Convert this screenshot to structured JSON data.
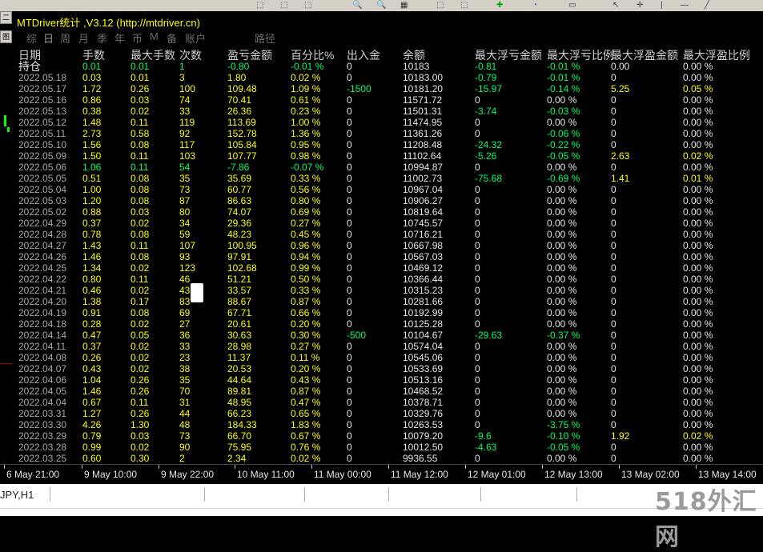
{
  "window": {
    "title": "MTDriver统计 ,V3.12 (http://mtdriver.cn)"
  },
  "tabs": [
    "综",
    "日",
    "周",
    "月",
    "季",
    "年",
    "币",
    "M",
    "备",
    "账户",
    "路径"
  ],
  "columns": [
    "日期",
    "手数",
    "最大手数",
    "次数",
    "盈亏金额",
    "百分比%",
    "出入金",
    "余额",
    "最大浮亏金额",
    "最大浮亏比例",
    "最大浮盈金额",
    "最大浮盈比例"
  ],
  "holding": {
    "label": "持仓",
    "lots": "0.01",
    "max_lots": "0.01",
    "count": "1",
    "pnl": "-0.80",
    "pct": "-0.01 %",
    "flow": "0",
    "balance": "10183",
    "max_loss": "-0.81",
    "max_loss_pct": "-0.01 %",
    "max_gain": "0.00",
    "max_gain_pct": "0.00 %"
  },
  "rows": [
    [
      "2022.05.18",
      "0.03",
      "0.01",
      "3",
      "1.80",
      "0.02 %",
      "0",
      "10183.00",
      "-0.79",
      "-0.01 %",
      "0",
      "0.00 %"
    ],
    [
      "2022.05.17",
      "1.72",
      "0.26",
      "100",
      "109.48",
      "1.09 %",
      "-1500",
      "10181.20",
      "-15.97",
      "-0.14 %",
      "5.25",
      "0.05 %"
    ],
    [
      "2022.05.16",
      "0.86",
      "0.03",
      "74",
      "70.41",
      "0.61 %",
      "0",
      "11571.72",
      "0",
      "0.00 %",
      "0",
      "0.00 %"
    ],
    [
      "2022.05.13",
      "0.38",
      "0.02",
      "33",
      "26.36",
      "0.23 %",
      "0",
      "11501.31",
      "-3.74",
      "-0.03 %",
      "0",
      "0.00 %"
    ],
    [
      "2022.05.12",
      "1.48",
      "0.11",
      "119",
      "113.69",
      "1.00 %",
      "0",
      "11474.95",
      "0",
      "0.00 %",
      "0",
      "0.00 %"
    ],
    [
      "2022.05.11",
      "2.73",
      "0.58",
      "92",
      "152.78",
      "1.36 %",
      "0",
      "11361.26",
      "0",
      "-0.06 %",
      "0",
      "0.00 %"
    ],
    [
      "2022.05.10",
      "1.56",
      "0.08",
      "117",
      "105.84",
      "0.95 %",
      "0",
      "11208.48",
      "-24.32",
      "-0.22 %",
      "0",
      "0.00 %"
    ],
    [
      "2022.05.09",
      "1.50",
      "0.11",
      "103",
      "107.77",
      "0.98 %",
      "0",
      "11102.64",
      "-5.26",
      "-0.05 %",
      "2.63",
      "0.02 %"
    ],
    [
      "2022.05.06",
      "1.06",
      "0.11",
      "54",
      "-7.86",
      "-0.07 %",
      "0",
      "10994.87",
      "0",
      "0.00 %",
      "0",
      "0.00 %"
    ],
    [
      "2022.05.05",
      "0.51",
      "0.08",
      "35",
      "35.69",
      "0.33 %",
      "0",
      "11002.73",
      "-75.68",
      "-0.69 %",
      "1.41",
      "0.01 %"
    ],
    [
      "2022.05.04",
      "1.00",
      "0.08",
      "73",
      "60.77",
      "0.56 %",
      "0",
      "10967.04",
      "0",
      "0.00 %",
      "0",
      "0.00 %"
    ],
    [
      "2022.05.03",
      "1.20",
      "0.08",
      "87",
      "86.63",
      "0.80 %",
      "0",
      "10906.27",
      "0",
      "0.00 %",
      "0",
      "0.00 %"
    ],
    [
      "2022.05.02",
      "0.88",
      "0.03",
      "80",
      "74.07",
      "0.69 %",
      "0",
      "10819.64",
      "0",
      "0.00 %",
      "0",
      "0.00 %"
    ],
    [
      "2022.04.29",
      "0.37",
      "0.02",
      "34",
      "29.36",
      "0.27 %",
      "0",
      "10745.57",
      "0",
      "0.00 %",
      "0",
      "0.00 %"
    ],
    [
      "2022.04.28",
      "0.78",
      "0.08",
      "59",
      "48.23",
      "0.45 %",
      "0",
      "10716.21",
      "0",
      "0.00 %",
      "0",
      "0.00 %"
    ],
    [
      "2022.04.27",
      "1.43",
      "0.11",
      "107",
      "100.95",
      "0.96 %",
      "0",
      "10667.98",
      "0",
      "0.00 %",
      "0",
      "0.00 %"
    ],
    [
      "2022.04.26",
      "1.46",
      "0.08",
      "93",
      "97.91",
      "0.94 %",
      "0",
      "10567.03",
      "0",
      "0.00 %",
      "0",
      "0.00 %"
    ],
    [
      "2022.04.25",
      "1.34",
      "0.02",
      "123",
      "102.68",
      "0.99 %",
      "0",
      "10469.12",
      "0",
      "0.00 %",
      "0",
      "0.00 %"
    ],
    [
      "2022.04.22",
      "0.80",
      "0.11",
      "46",
      "51.21",
      "0.50 %",
      "0",
      "10366.44",
      "0",
      "0.00 %",
      "0",
      "0.00 %"
    ],
    [
      "2022.04.21",
      "0.46",
      "0.02",
      "43",
      "33.57",
      "0.33 %",
      "0",
      "10315.23",
      "0",
      "0.00 %",
      "0",
      "0.00 %"
    ],
    [
      "2022.04.20",
      "1.38",
      "0.17",
      "83",
      "88.67",
      "0.87 %",
      "0",
      "10281.66",
      "0",
      "0.00 %",
      "0",
      "0.00 %"
    ],
    [
      "2022.04.19",
      "0.91",
      "0.08",
      "69",
      "67.71",
      "0.66 %",
      "0",
      "10192.99",
      "0",
      "0.00 %",
      "0",
      "0.00 %"
    ],
    [
      "2022.04.18",
      "0.28",
      "0.02",
      "27",
      "20.61",
      "0.20 %",
      "0",
      "10125.28",
      "0",
      "0.00 %",
      "0",
      "0.00 %"
    ],
    [
      "2022.04.14",
      "0.47",
      "0.05",
      "36",
      "30.63",
      "0.30 %",
      "-500",
      "10104.67",
      "-29.63",
      "-0.37 %",
      "0",
      "0.00 %"
    ],
    [
      "2022.04.11",
      "0.37",
      "0.02",
      "33",
      "28.98",
      "0.27 %",
      "0",
      "10574.04",
      "0",
      "0.00 %",
      "0",
      "0.00 %"
    ],
    [
      "2022.04.08",
      "0.26",
      "0.02",
      "23",
      "11.37",
      "0.11 %",
      "0",
      "10545.06",
      "0",
      "0.00 %",
      "0",
      "0.00 %"
    ],
    [
      "2022.04.07",
      "0.43",
      "0.02",
      "38",
      "20.53",
      "0.20 %",
      "0",
      "10533.69",
      "0",
      "0.00 %",
      "0",
      "0.00 %"
    ],
    [
      "2022.04.06",
      "1.04",
      "0.26",
      "35",
      "44.64",
      "0.43 %",
      "0",
      "10513.16",
      "0",
      "0.00 %",
      "0",
      "0.00 %"
    ],
    [
      "2022.04.05",
      "1.46",
      "0.26",
      "70",
      "89.81",
      "0.87 %",
      "0",
      "10468.52",
      "0",
      "0.00 %",
      "0",
      "0.00 %"
    ],
    [
      "2022.04.04",
      "0.67",
      "0.11",
      "31",
      "48.95",
      "0.47 %",
      "0",
      "10378.71",
      "0",
      "0.00 %",
      "0",
      "0.00 %"
    ],
    [
      "2022.03.31",
      "1.27",
      "0.26",
      "44",
      "66.23",
      "0.65 %",
      "0",
      "10329.76",
      "0",
      "0.00 %",
      "0",
      "0.00 %"
    ],
    [
      "2022.03.30",
      "4.26",
      "1.30",
      "48",
      "184.33",
      "1.83 %",
      "0",
      "10263.53",
      "0",
      "-3.75 %",
      "0",
      "0.00 %"
    ],
    [
      "2022.03.29",
      "0.79",
      "0.03",
      "73",
      "66.70",
      "0.67 %",
      "0",
      "10079.20",
      "-9.6",
      "-0.10 %",
      "1.92",
      "0.02 %"
    ],
    [
      "2022.03.28",
      "0.99",
      "0.02",
      "90",
      "75.95",
      "0.76 %",
      "0",
      "10012.50",
      "-4.63",
      "-0.05 %",
      "0",
      "0.00 %"
    ],
    [
      "2022.03.25",
      "0.60",
      "0.30",
      "2",
      "2.34",
      "0.02 %",
      "0",
      "9936.55",
      "0",
      "0.00 %",
      "0",
      "0.00 %"
    ]
  ],
  "time_axis": [
    "6 May 21:00",
    "9 May 10:00",
    "9 May 22:00",
    "10 May 11:00",
    "11 May 00:00",
    "11 May 12:00",
    "12 May 01:00",
    "12 May 13:00",
    "13 May 02:00",
    "13 May 14:00"
  ],
  "status": {
    "symbol": "JPY,H1"
  },
  "watermark": "518外汇网",
  "sidebar": [
    "二",
    "图"
  ],
  "colors": {
    "positive": "#ffff00",
    "negative": "#00ff66",
    "neutral": "#e6e6e6",
    "title": "#ffff00"
  }
}
